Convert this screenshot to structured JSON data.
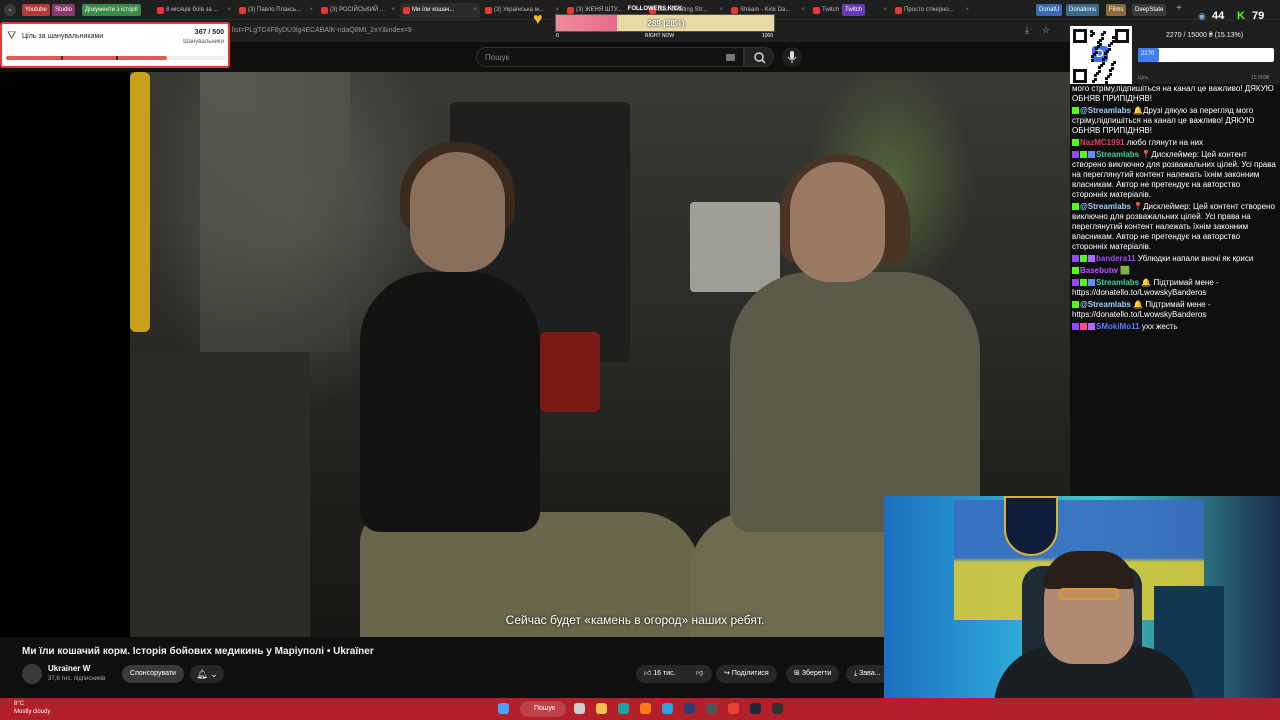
{
  "browser": {
    "bookmarks": [
      {
        "label": "Youtube",
        "color": "#b23a3a"
      },
      {
        "label": "Studio",
        "color": "#8a3a6a"
      },
      {
        "label": "Документи з історії",
        "color": "#3a8a4a"
      }
    ],
    "tabs": [
      {
        "label": "8 місяців боїв за ...",
        "active": false
      },
      {
        "label": "(3) Павло Плаксь...",
        "active": false
      },
      {
        "label": "(3) РОСІЙСЬКИЙ ...",
        "active": false
      },
      {
        "label": "Ми їли кошач...",
        "active": true
      },
      {
        "label": "(3) Українська м...",
        "active": false
      },
      {
        "label": "(3) ЖЕНЯ ШТУ...",
        "active": false
      },
      {
        "label": "Just Chatting Str...",
        "active": false
      },
      {
        "label": "Stream - Kick Da...",
        "active": false
      },
      {
        "label": "Twitch",
        "active": false
      },
      {
        "label": "Просто стікерно...",
        "active": false
      }
    ],
    "right_bookmarks": [
      {
        "label": "Twitch",
        "color": "#6a3ab0"
      },
      {
        "label": "DonatU",
        "color": "#3a6ab0"
      },
      {
        "label": "Donations",
        "color": "#3a6a8a"
      },
      {
        "label": "Films",
        "color": "#8a6a3a"
      },
      {
        "label": "DeepState",
        "color": "#3a3a3a"
      }
    ],
    "url": "list=PLgTC4F8yDU3lg4ECABAlK-ndaQ8Mt_2xY&index=9"
  },
  "search": {
    "placeholder": "Пошук"
  },
  "video": {
    "subtitle": "Сейчас будет «камень в огород» наших ребят.",
    "title": "Ми їли кошачий корм. Історія бойових медикинь у Маріуполі • Ukraїner",
    "channel": "Ukraїner W",
    "subscribers": "37,6 тис. підписників",
    "sponsor_label": "Спонсорувати",
    "likes": "16 тис.",
    "share_label": "Поділитися",
    "save_label": "Зберегти",
    "more_label": "Зава..."
  },
  "goal_widget": {
    "title": "Ціль за шанувальниками",
    "count": "367 / 500",
    "unit": "Шанувальники",
    "progress": 0.734
  },
  "kick_widget": {
    "title": "FOLLOWERS KICK",
    "value_text": "289 (28%)",
    "progress": 0.28,
    "min": "0",
    "mid": "RIGHT NOW",
    "max": "1000"
  },
  "counters": {
    "viewers": "44",
    "kick": "79"
  },
  "donation_widget": {
    "text": "2270 / 15000 ₴ (15.13%)",
    "value": "2270",
    "progress": 0.1513,
    "min": "Ціль",
    "max": "15 000₴"
  },
  "chat": [
    {
      "user": "",
      "text": "мого стріму,підпишіться на канал це важливо! ДЯКУЮ ОБНЯВ ПРИПІДНЯВ!",
      "color": "#ffffff",
      "badges": []
    },
    {
      "user": "@Streamlabs",
      "text": "🔔Друзі дякую за перегляд мого стріму,підпишіться на канал це важливо! ДЯКУЮ ОБНЯВ ПРИПІДНЯВ!",
      "color": "#9ad0ff",
      "badges": [
        "#53fc18"
      ]
    },
    {
      "user": "NazMC1991",
      "text": "любо глянути на них",
      "color": "#e0405a",
      "badges": [
        "#53fc18"
      ]
    },
    {
      "user": "Streamlabs",
      "text": "📍Дисклеймер: Цей контент створено виключно для розважальних цілей. Усі права на переглянутий контент належать їхнім законним власникам. Автор не претендує на авторство сторонніх матеріалів.",
      "color": "#3ad0a0",
      "badges": [
        "#9147ff",
        "#53fc18",
        "#6a8aff"
      ]
    },
    {
      "user": "@Streamlabs",
      "text": "📍Дисклеймер: Цей контент створено виключно для розважальних цілей. Усі права на переглянутий контент належать їхнім законним власникам. Автор не претендує на авторство сторонніх матеріалів.",
      "color": "#9ad0ff",
      "badges": [
        "#53fc18"
      ]
    },
    {
      "user": "bandera11",
      "text": "Ублюдки напали вночі як криси",
      "color": "#a04aff",
      "badges": [
        "#9147ff",
        "#53fc18",
        "#b06aff"
      ]
    },
    {
      "user": "Basebutw",
      "text": "🟩",
      "color": "#c050ff",
      "badges": [
        "#53fc18"
      ]
    },
    {
      "user": "Streamlabs",
      "text": "🔔 Підтримай мене - https://donatello.to/LwowskyBanderos",
      "color": "#3ad0a0",
      "badges": [
        "#9147ff",
        "#53fc18",
        "#6a8aff"
      ]
    },
    {
      "user": "@Streamlabs",
      "text": "🔔 Підтримай мене - https://donatello.to/LwowskyBanderos",
      "color": "#9ad0ff",
      "badges": [
        "#53fc18"
      ]
    },
    {
      "user": "SMokiMo11",
      "text": "ухх жесть",
      "color": "#5a7aff",
      "badges": [
        "#9147ff",
        "#ff4a8a",
        "#b06aff"
      ]
    }
  ],
  "taskbar": {
    "temperature": "8°C",
    "weather": "Mostly cloudy",
    "search_label": "Пошук"
  }
}
